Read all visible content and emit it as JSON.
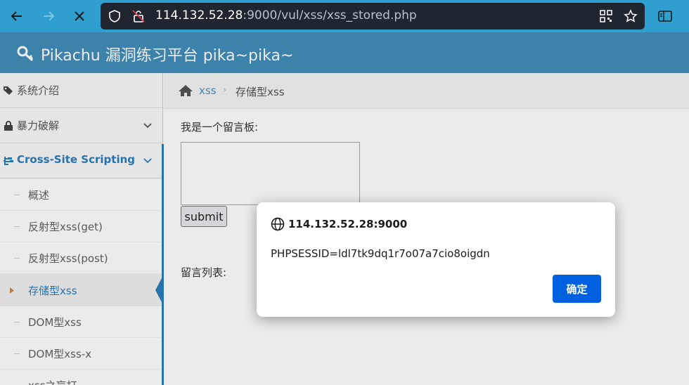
{
  "browser": {
    "url_host": "114.132.52.28",
    "url_rest": ":9000/vul/xss/xss_stored.php"
  },
  "header": {
    "title": "Pikachu 漏洞练习平台 pika~pika~"
  },
  "sidebar": {
    "items": [
      {
        "label": "系统介绍"
      },
      {
        "label": "暴力破解"
      },
      {
        "label": "Cross-Site Scripting"
      }
    ],
    "sub_items": [
      {
        "label": "概述"
      },
      {
        "label": "反射型xss(get)"
      },
      {
        "label": "反射型xss(post)"
      },
      {
        "label": "存储型xss"
      },
      {
        "label": "DOM型xss"
      },
      {
        "label": "DOM型xss-x"
      },
      {
        "label": "xss之盲打"
      }
    ]
  },
  "breadcrumb": {
    "link": "xss",
    "separator": "›",
    "current": "存储型xss"
  },
  "main": {
    "board_label": "我是一个留言板:",
    "submit_label": "submit",
    "list_label": "留言列表:"
  },
  "dialog": {
    "origin": "114.132.52.28:9000",
    "message": "PHPSESSID=ldl7tk9dq1r7o07a7cio8oigdn",
    "ok_label": "确定"
  },
  "colors": {
    "browser_bar": "#2f9fd0",
    "header": "#438eb9",
    "accent": "#2b7dbc",
    "dialog_button": "#0061e0"
  }
}
